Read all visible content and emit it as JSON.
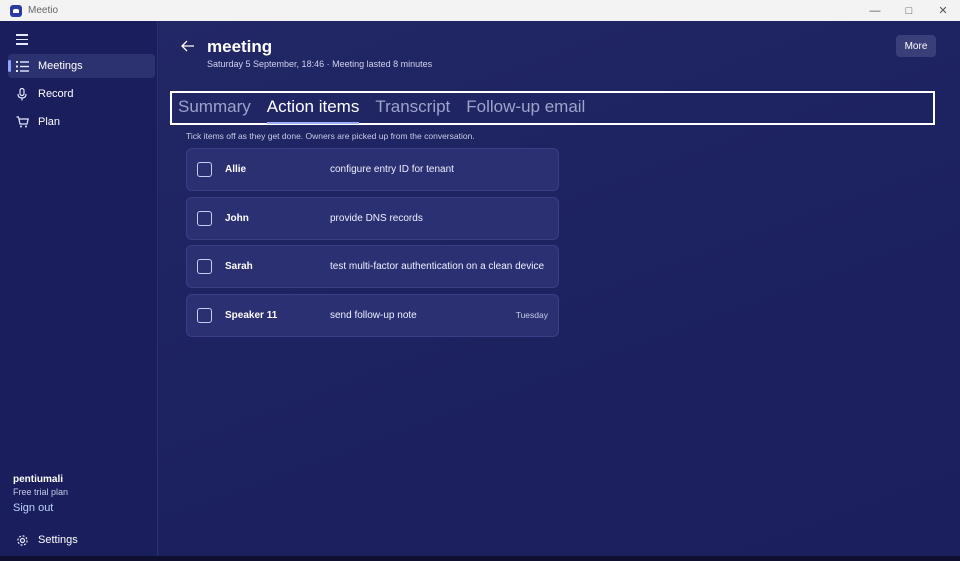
{
  "window": {
    "title": "Meetio"
  },
  "sidebar": {
    "items": [
      {
        "label": "Meetings",
        "icon": "list-icon",
        "active": true
      },
      {
        "label": "Record",
        "icon": "microphone-icon",
        "active": false
      },
      {
        "label": "Plan",
        "icon": "cart-icon",
        "active": false
      }
    ],
    "user": {
      "name": "pentiumali",
      "plan": "Free trial plan"
    },
    "sign_out": "Sign out",
    "settings": "Settings"
  },
  "header": {
    "title": "meeting",
    "subtitle": "Saturday 5 September, 18:46 · Meeting lasted 8 minutes",
    "more_label": "More"
  },
  "tabs": [
    {
      "label": "Summary",
      "active": false
    },
    {
      "label": "Action items",
      "active": true
    },
    {
      "label": "Transcript",
      "active": false
    },
    {
      "label": "Follow-up email",
      "active": false
    }
  ],
  "action_items": {
    "hint": "Tick items off as they get done. Owners are picked up from the conversation.",
    "items": [
      {
        "owner": "Allie",
        "task": "configure entry ID for tenant",
        "due": ""
      },
      {
        "owner": "John",
        "task": "provide DNS records",
        "due": ""
      },
      {
        "owner": "Sarah",
        "task": "test multi-factor authentication on a clean device",
        "due": ""
      },
      {
        "owner": "Speaker 11",
        "task": "send follow-up note",
        "due": "Tuesday"
      }
    ]
  },
  "colors": {
    "background": "#1d2160",
    "accent": "#9fb0ff",
    "card": "#2b3072"
  }
}
